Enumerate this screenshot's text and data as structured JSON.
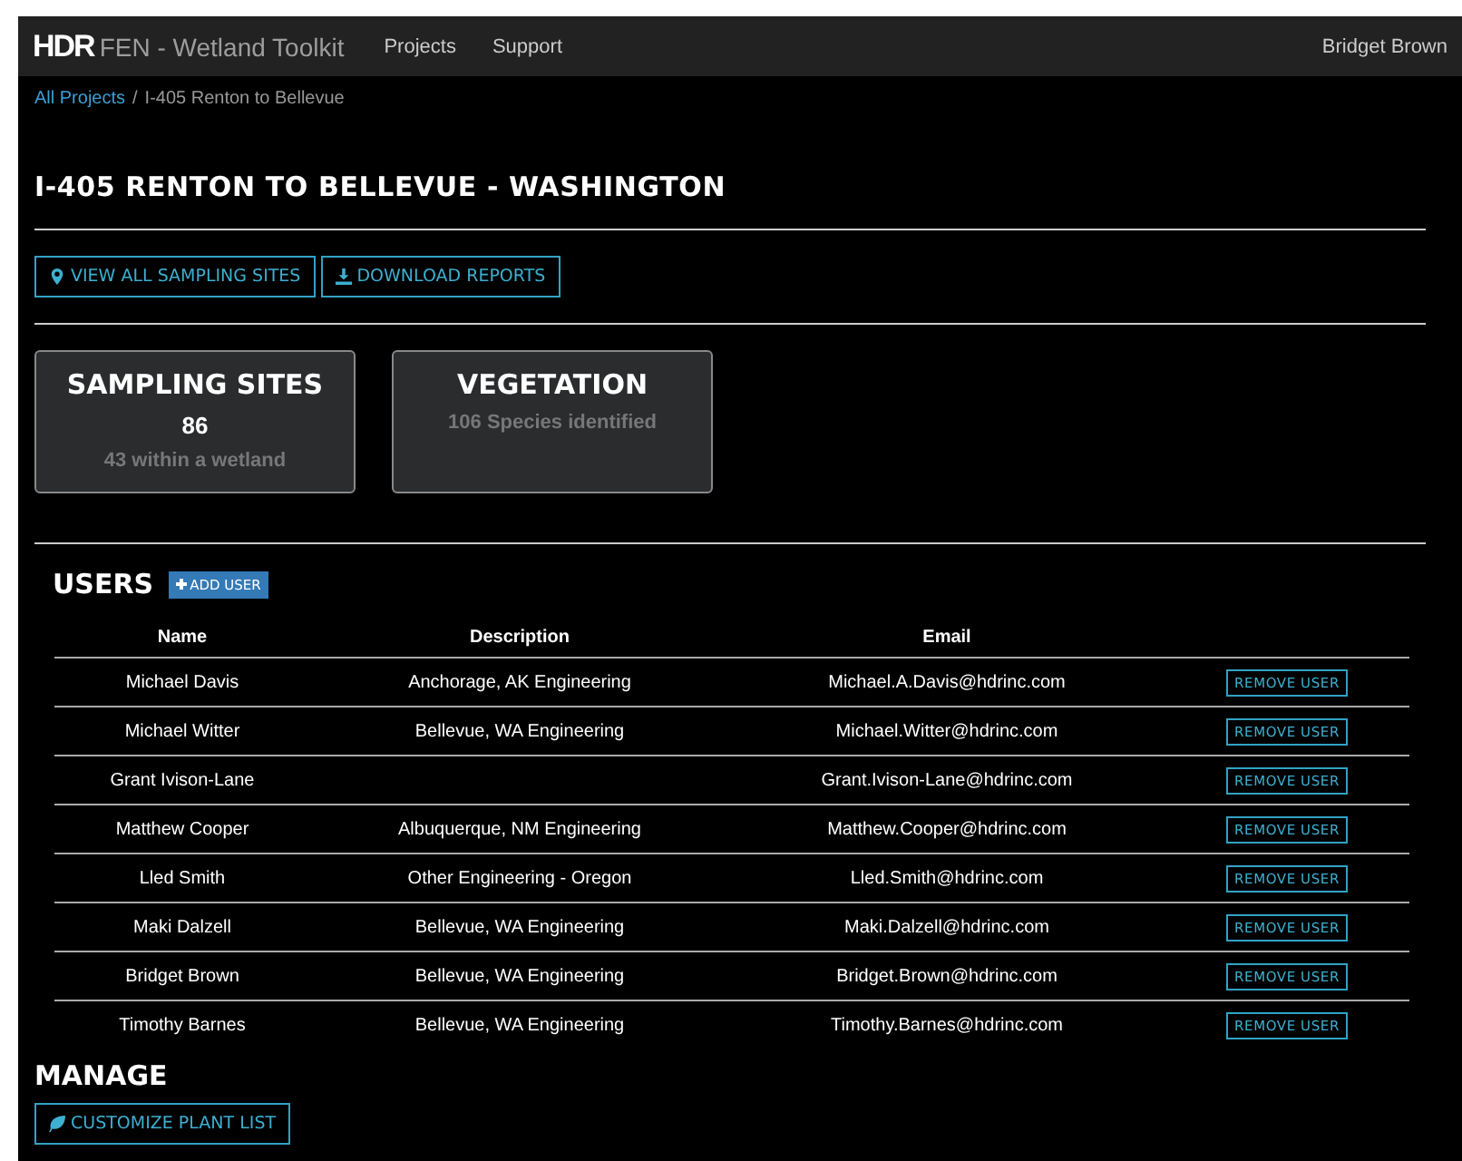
{
  "navbar": {
    "logo": "HDR",
    "title": "FEN - Wetland Toolkit",
    "links": [
      "Projects",
      "Support"
    ],
    "user": "Bridget Brown"
  },
  "breadcrumb": {
    "link": "All Projects",
    "separator": "/",
    "current": "I-405 Renton to Bellevue"
  },
  "title": "I-405 RENTON TO BELLEVUE - WASHINGTON",
  "actions": [
    {
      "label": "VIEW ALL SAMPLING SITES"
    },
    {
      "label": "DOWNLOAD REPORTS"
    }
  ],
  "stats": [
    {
      "title": "SAMPLING SITES",
      "value": "86",
      "note": "43 within a wetland"
    },
    {
      "title": "VEGETATION",
      "note": "106 Species identified"
    }
  ],
  "users": {
    "heading": "USERS",
    "add_button": "ADD USER",
    "columns": [
      "Name",
      "Description",
      "Email"
    ],
    "rows": [
      {
        "name": "Michael Davis",
        "description": "Anchorage, AK Engineering",
        "email": "Michael.A.Davis@hdrinc.com",
        "action": "REMOVE USER"
      },
      {
        "name": "Michael Witter",
        "description": "Bellevue, WA Engineering",
        "email": "Michael.Witter@hdrinc.com",
        "action": "REMOVE USER"
      },
      {
        "name": "Grant Ivison-Lane",
        "email": "Grant.Ivison-Lane@hdrinc.com",
        "action": "REMOVE USER"
      },
      {
        "name": "Matthew Cooper",
        "description": "Albuquerque, NM Engineering",
        "email": "Matthew.Cooper@hdrinc.com",
        "action": "REMOVE USER"
      },
      {
        "name": "Lled Smith",
        "description": "Other Engineering - Oregon",
        "email": "Lled.Smith@hdrinc.com",
        "action": "REMOVE USER"
      },
      {
        "name": "Maki Dalzell",
        "description": "Bellevue, WA Engineering",
        "email": "Maki.Dalzell@hdrinc.com",
        "action": "REMOVE USER"
      },
      {
        "name": "Bridget Brown",
        "description": "Bellevue, WA Engineering",
        "email": "Bridget.Brown@hdrinc.com",
        "action": "REMOVE USER"
      },
      {
        "name": "Timothy Barnes",
        "description": "Bellevue, WA Engineering",
        "email": "Timothy.Barnes@hdrinc.com",
        "action": "REMOVE USER"
      }
    ]
  },
  "manage": {
    "heading": "MANAGE",
    "buttons": [
      {
        "label": "CUSTOMIZE PLANT LIST"
      }
    ]
  }
}
